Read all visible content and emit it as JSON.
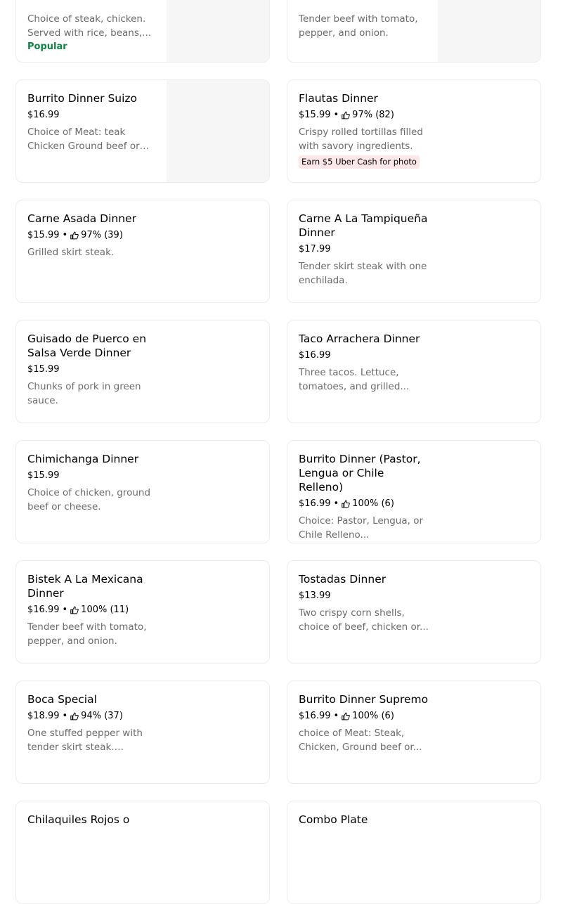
{
  "colors": {
    "popular_green": "#0e8345",
    "photo_badge_bg": "#fde8e7",
    "desc_gray": "#6b6b6b",
    "card_border": "#ececec",
    "image_placeholder": "#f6f6f6"
  },
  "icons": {
    "rating": "thumbs-up-icon"
  },
  "items": [
    {
      "title": "",
      "price": "",
      "rating": "",
      "description": "Choice of steak, chicken. Served with rice, beans,...",
      "badge_popular": "Popular"
    },
    {
      "title": "",
      "price": "",
      "rating": "",
      "description": "Tender beef with tomato, pepper, and onion."
    },
    {
      "title": "Burrito Dinner Suizo",
      "price": "$16.99",
      "rating": "",
      "description": "Choice of Meat: teak Chicken Ground beef or Po..."
    },
    {
      "title": "Flautas Dinner",
      "price": "$15.99",
      "rating": "97% (82)",
      "description": "Crispy rolled tortillas filled with savory ingredients.",
      "badge_photo": "Earn $5 Uber Cash for photo"
    },
    {
      "title": "Carne Asada Dinner",
      "price": "$15.99",
      "rating": "97% (39)",
      "description": "Grilled skirt steak."
    },
    {
      "title": "Carne A La Tampiqueña Dinner",
      "price": "$17.99",
      "rating": "",
      "description": "Tender skirt steak with one enchilada."
    },
    {
      "title": "Guisado de Puerco en Salsa Verde Dinner",
      "price": "$15.99",
      "rating": "",
      "description": "Chunks of pork in green sauce."
    },
    {
      "title": "Taco Arrachera Dinner",
      "price": "$16.99",
      "rating": "",
      "description": "Three tacos. Lettuce, tomatoes, and grilled..."
    },
    {
      "title": "Chimichanga Dinner",
      "price": "$15.99",
      "rating": "",
      "description": "Choice of chicken, ground beef or cheese."
    },
    {
      "title": "Burrito Dinner (Pastor, Lengua or Chile Relleno)",
      "price": "$16.99",
      "rating": "100% (6)",
      "description": "Choice: Pastor, Lengua, or Chile Relleno..."
    },
    {
      "title": "Bistek A La Mexicana Dinner",
      "price": "$16.99",
      "rating": "100% (11)",
      "description": "Tender beef with tomato, pepper, and onion."
    },
    {
      "title": "Tostadas Dinner",
      "price": "$13.99",
      "rating": "",
      "description": "Two crispy corn shells, choice of beef, chicken or..."
    },
    {
      "title": "Boca Special",
      "price": "$18.99",
      "rating": "94% (37)",
      "description": "One stuffed pepper with tender skirt steak. Served..."
    },
    {
      "title": "Burrito Dinner Supremo",
      "price": "$16.99",
      "rating": "100% (6)",
      "description": "choice of Meat: Steak, Chicken, Ground beef or..."
    },
    {
      "title": "Chilaquiles Rojos o",
      "price": "",
      "rating": "",
      "description": ""
    },
    {
      "title": "Combo Plate",
      "price": "",
      "rating": "",
      "description": ""
    }
  ]
}
